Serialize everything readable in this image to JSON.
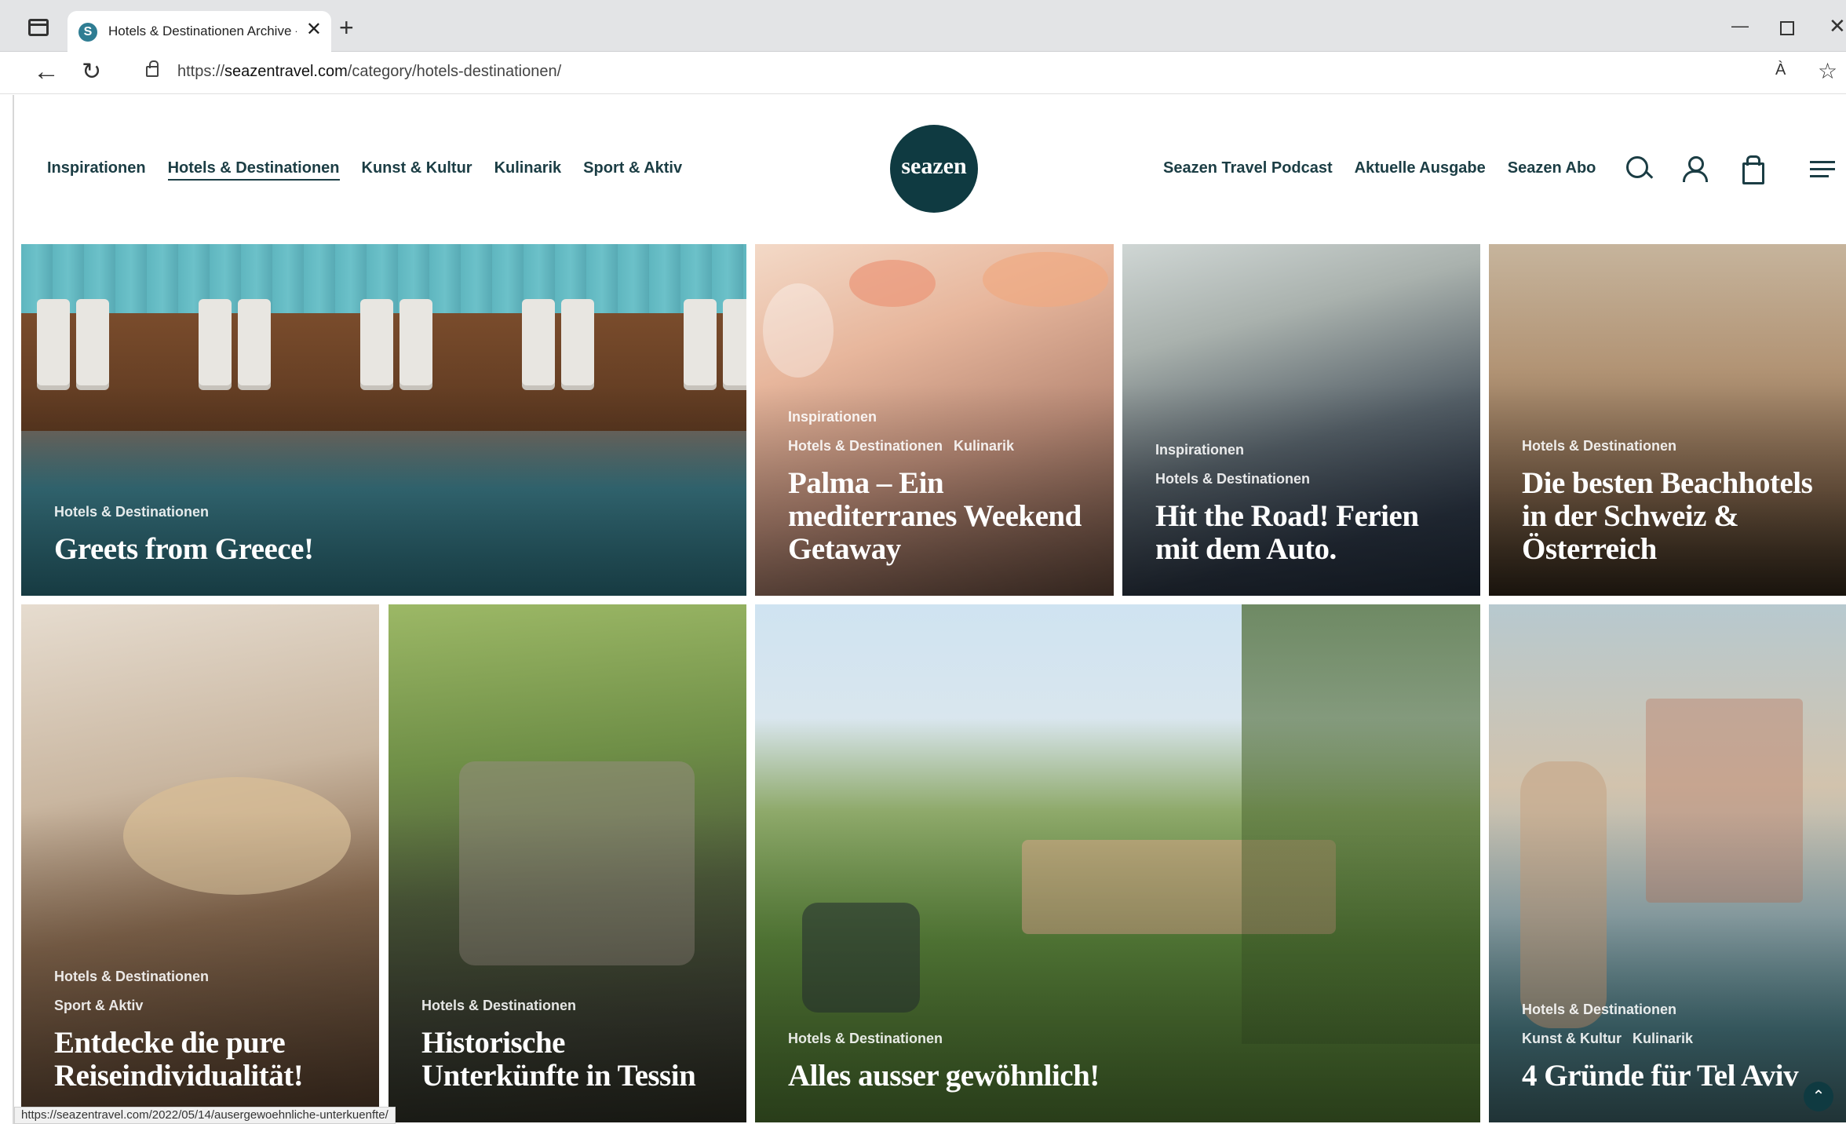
{
  "browser": {
    "tab_title": "Hotels & Destinationen Archive -",
    "favicon_letter": "S",
    "new_tab": "+",
    "close": "✕",
    "url_scheme": "https://",
    "url_host": "seazentravel.com",
    "url_path": "/category/hotels-destinationen/",
    "read_aloud": "À",
    "status_url": "https://seazentravel.com/2022/05/14/ausergewoehnliche-unterkuenfte/"
  },
  "site": {
    "logo": "seazen",
    "nav_left": [
      "Inspirationen",
      "Hotels & Destinationen",
      "Kunst & Kultur",
      "Kulinarik",
      "Sport & Aktiv"
    ],
    "nav_right": [
      "Seazen Travel Podcast",
      "Aktuelle Ausgabe",
      "Seazen Abo"
    ],
    "active_nav": "Hotels & Destinationen",
    "accent_color": "#1b3d44",
    "logo_color": "#0f3a41"
  },
  "articles": [
    {
      "categories": [
        "Hotels & Destinationen"
      ],
      "title": "Greets from Greece!"
    },
    {
      "categories": [
        "Inspirationen",
        "Hotels & Destinationen",
        "Kulinarik"
      ],
      "title": "Palma – Ein mediterranes Weekend Getaway"
    },
    {
      "categories": [
        "Inspirationen",
        "Hotels & Destinationen"
      ],
      "title": "Hit the Road! Ferien mit dem Auto."
    },
    {
      "categories": [
        "Hotels & Destinationen"
      ],
      "title": "Die besten Beachhotels in der Schweiz & Österreich"
    },
    {
      "categories": [
        "Hotels & Destinationen",
        "Sport & Aktiv"
      ],
      "title": "Entdecke die pure Reiseindividualität!"
    },
    {
      "categories": [
        "Hotels & Destinationen"
      ],
      "title": "Historische Unterkünfte in Tessin"
    },
    {
      "categories": [
        "Hotels & Destinationen"
      ],
      "title": "Alles ausser gewöhnlich!"
    },
    {
      "categories": [
        "Hotels & Destinationen",
        "Kunst & Kultur",
        "Kulinarik"
      ],
      "title": "4 Gründe für Tel Aviv"
    }
  ],
  "icons": [
    "sidebar-icon",
    "back-arrow-icon",
    "reload-icon",
    "lock-icon",
    "read-aloud-icon",
    "favorite-star-icon",
    "search-icon",
    "account-icon",
    "shopping-bag-icon",
    "menu-icon",
    "scroll-top-icon"
  ]
}
